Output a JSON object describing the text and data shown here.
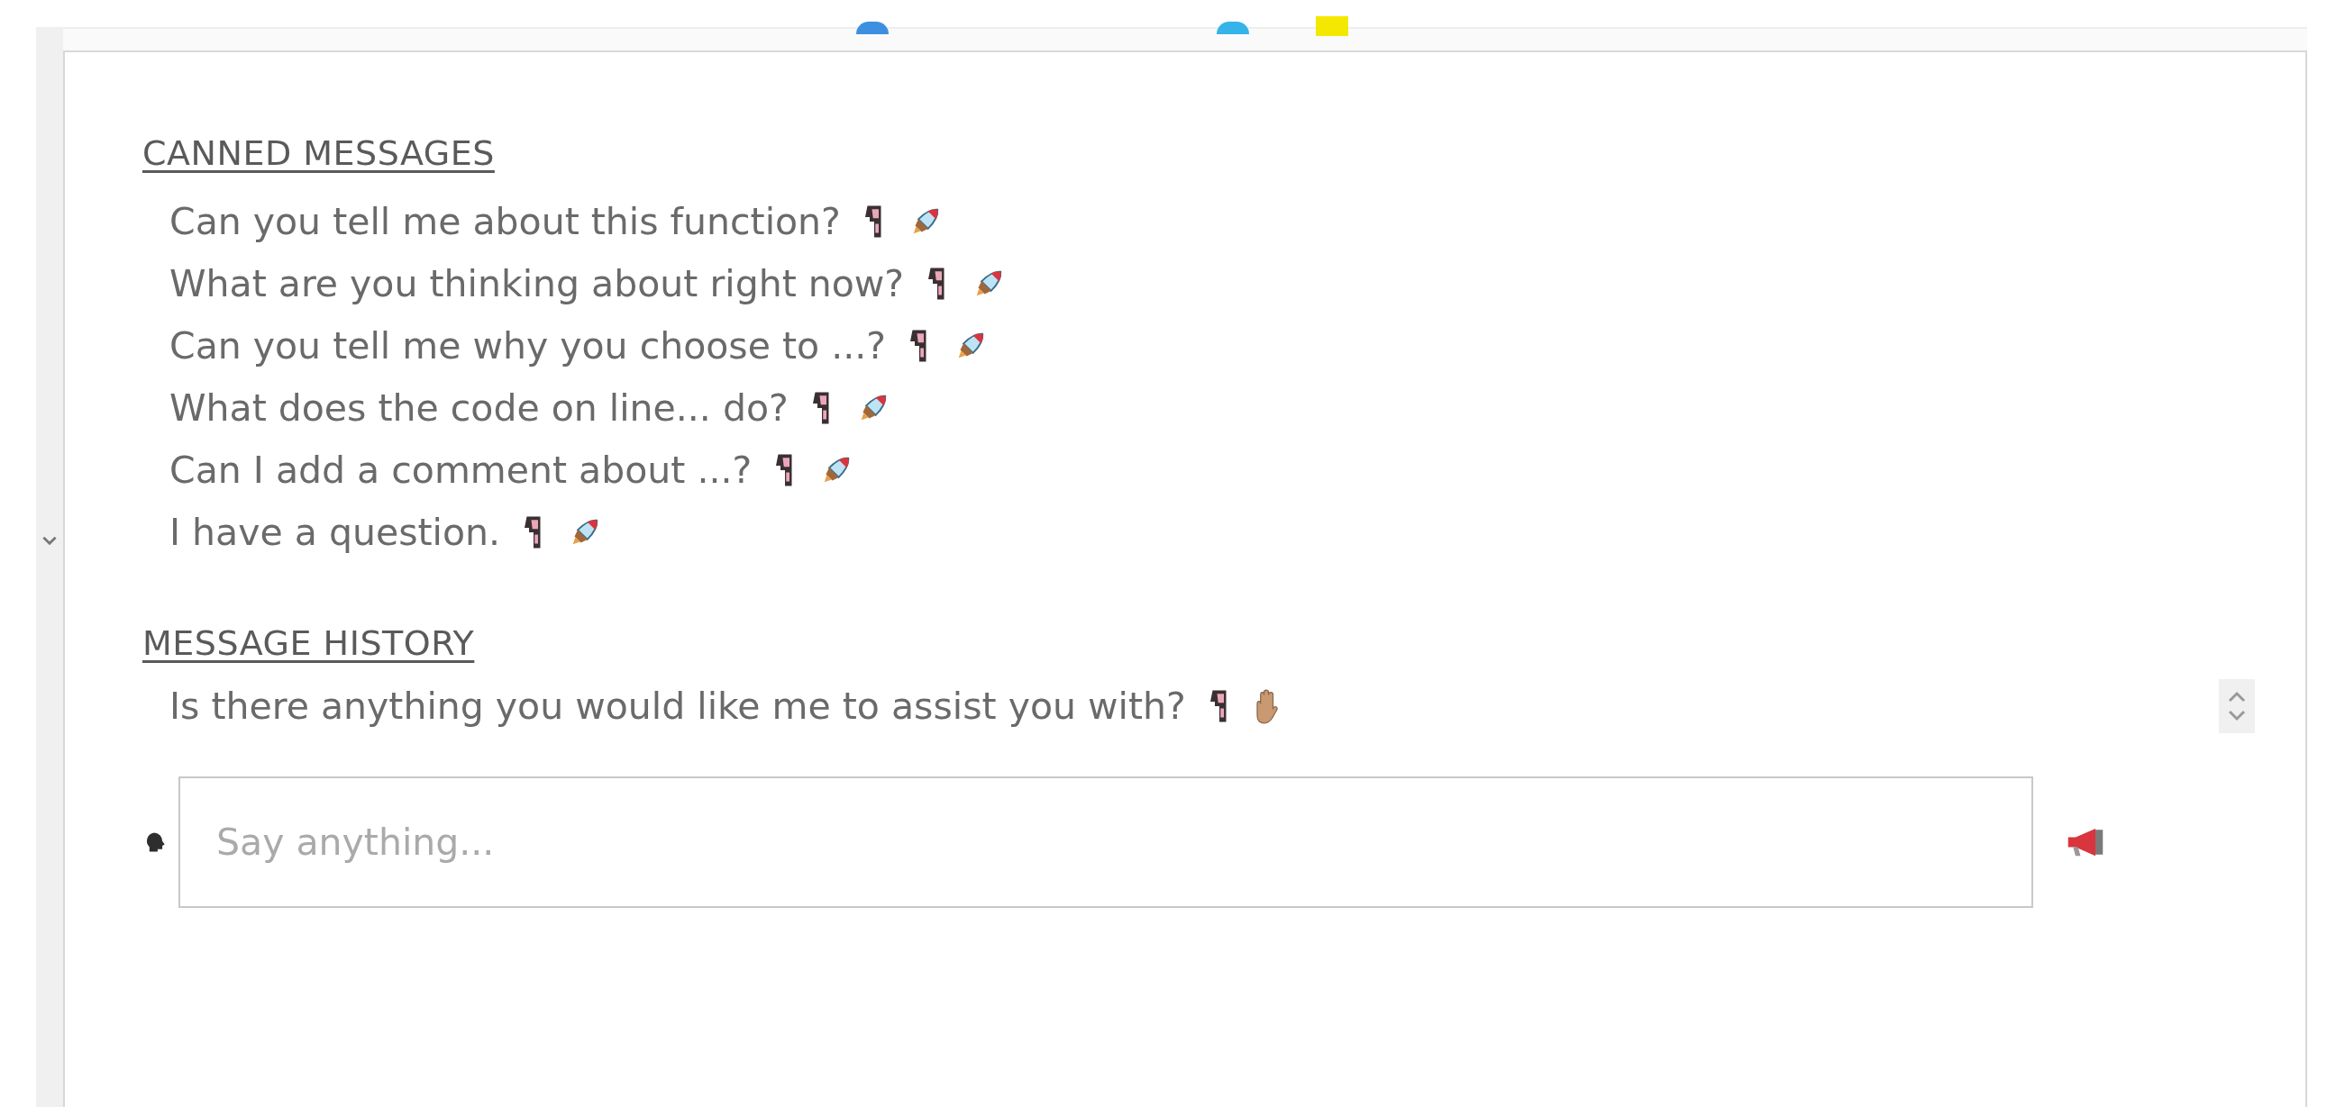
{
  "canned_messages": {
    "heading": "CANNED MESSAGES",
    "items": [
      "Can you tell me about this function?",
      "What are you thinking about right now?",
      "Can you tell me why you choose to ...?",
      "What does the code on line... do?",
      "Can I add a comment about ...?",
      "I have a question."
    ]
  },
  "message_history": {
    "heading": "MESSAGE HISTORY",
    "items": [
      "Is there anything you would like me to assist you with?"
    ]
  },
  "composer": {
    "placeholder": "Say anything..."
  }
}
